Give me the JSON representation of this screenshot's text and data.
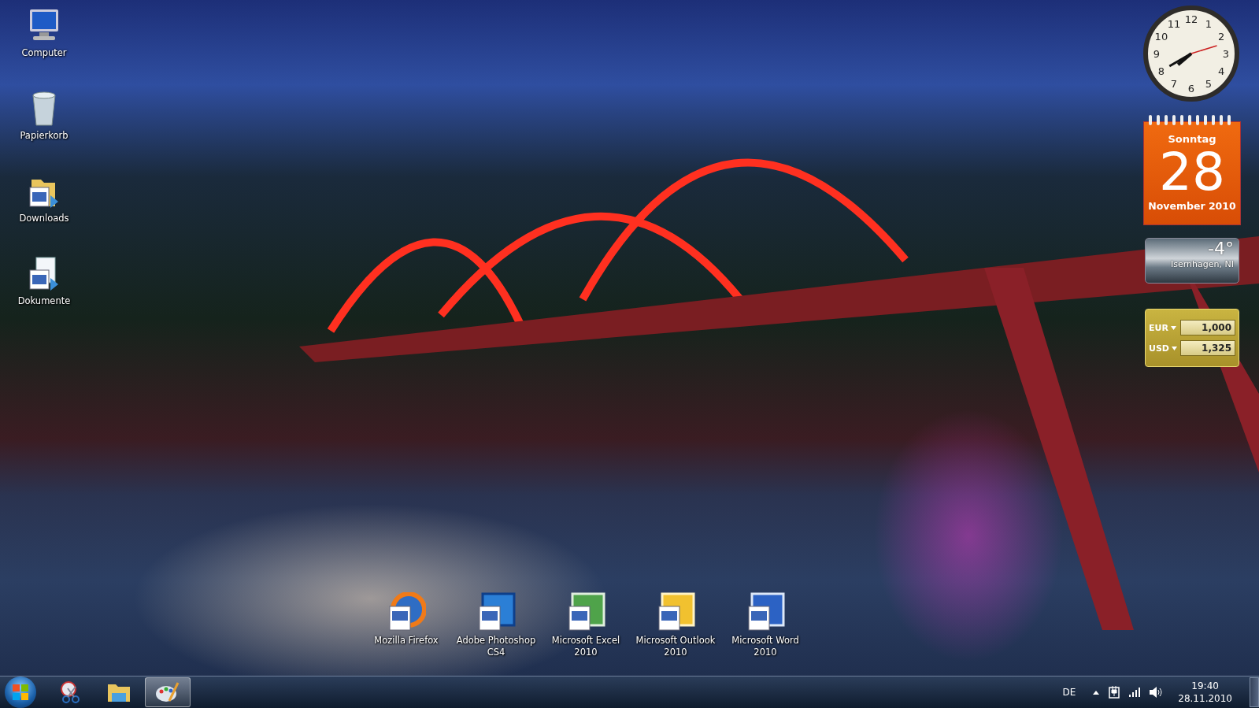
{
  "desktop_icons": [
    {
      "label": "Computer",
      "kind": "computer"
    },
    {
      "label": "Papierkorb",
      "kind": "recycle-bin"
    },
    {
      "label": "Downloads",
      "kind": "folder-shortcut"
    },
    {
      "label": "Dokumente",
      "kind": "document-shortcut"
    }
  ],
  "shortcuts": [
    {
      "label": "Mozilla Firefox",
      "kind": "firefox"
    },
    {
      "label": "Adobe Photoshop CS4",
      "kind": "photoshop"
    },
    {
      "label": "Microsoft Excel 2010",
      "kind": "excel"
    },
    {
      "label": "Microsoft Outlook 2010",
      "kind": "outlook"
    },
    {
      "label": "Microsoft Word 2010",
      "kind": "word"
    }
  ],
  "gadgets": {
    "clock": {
      "numerals": [
        "12",
        "11",
        "1",
        "10",
        "2",
        "9",
        "3",
        "8",
        "4",
        "7",
        "5",
        "6"
      ]
    },
    "calendar": {
      "weekday": "Sonntag",
      "day": "28",
      "month_year": "November 2010"
    },
    "weather": {
      "temperature": "-4°",
      "location": "Isernhagen, NI"
    },
    "currency": [
      {
        "code": "EUR",
        "amount": "1,000"
      },
      {
        "code": "USD",
        "amount": "1,325"
      }
    ]
  },
  "taskbar": {
    "apps": [
      {
        "kind": "snipping",
        "active": false
      },
      {
        "kind": "explorer",
        "active": false
      },
      {
        "kind": "paint",
        "active": true
      }
    ],
    "language": "DE",
    "time": "19:40",
    "date": "28.11.2010"
  }
}
